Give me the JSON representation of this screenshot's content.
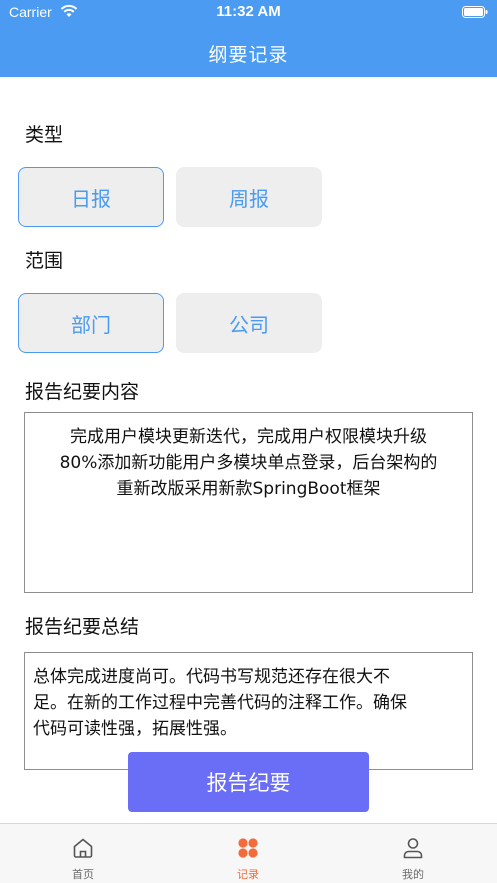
{
  "status_bar": {
    "carrier": "Carrier",
    "time": "11:32 AM"
  },
  "nav": {
    "title": "纲要记录"
  },
  "type_section": {
    "label": "类型",
    "options": [
      "日报",
      "周报"
    ],
    "selected": "日报"
  },
  "scope_section": {
    "label": "范围",
    "options": [
      "部门",
      "公司"
    ],
    "selected": "部门"
  },
  "content_section": {
    "label": "报告纪要内容",
    "lines": [
      "完成用户模块更新迭代，完成用户权限模块升级",
      "80%添加新功能用户多模块单点登录，后台架构的",
      "重新改版采用新款SpringBoot框架"
    ]
  },
  "summary_section": {
    "label": "报告纪要总结",
    "lines": [
      "总体完成进度尚可。代码书写规范还存在很大不",
      "足。在新的工作过程中完善代码的注释工作。确保",
      "代码可读性强，拓展性强。"
    ]
  },
  "submit": {
    "label": "报告纪要"
  },
  "tabs": [
    {
      "label": "首页",
      "icon": "home-icon"
    },
    {
      "label": "记录",
      "icon": "grid-icon",
      "active": true
    },
    {
      "label": "我的",
      "icon": "person-icon"
    }
  ],
  "colors": {
    "accent": "#4a9bf1",
    "submit": "#6a6df5",
    "active_tab": "#f26b3a"
  }
}
